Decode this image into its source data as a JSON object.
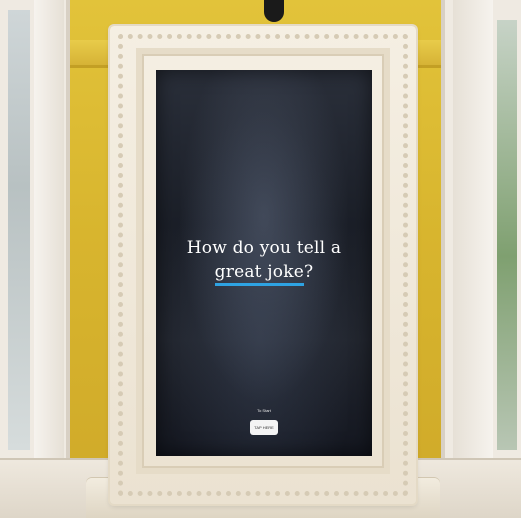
{
  "screen": {
    "headline_line1": "How do you tell a",
    "headline_highlight": "great joke",
    "headline_suffix": "?",
    "tap_caption": "To Start",
    "tap_button_label": "TAP HERE"
  },
  "colors": {
    "wall": "#d9b640",
    "frame": "#f1ebdf",
    "screen": "#1b1f28",
    "underline_accent": "#2ea3e3"
  }
}
